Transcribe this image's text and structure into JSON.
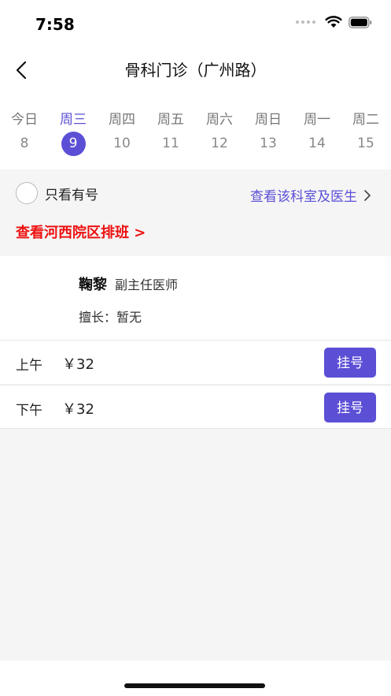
{
  "status_bar": {
    "time": "7:58",
    "icons": [
      "signal-icon",
      "wifi-icon",
      "battery-icon"
    ]
  },
  "nav": {
    "title": "骨科门诊（广州路）",
    "back_icon": "chevron-left-icon"
  },
  "dates": [
    {
      "weekday": "今日",
      "day": "8",
      "selected": false
    },
    {
      "weekday": "周三",
      "day": "9",
      "selected": true
    },
    {
      "weekday": "周四",
      "day": "10",
      "selected": false
    },
    {
      "weekday": "周五",
      "day": "11",
      "selected": false
    },
    {
      "weekday": "周六",
      "day": "12",
      "selected": false
    },
    {
      "weekday": "周日",
      "day": "13",
      "selected": false
    },
    {
      "weekday": "周一",
      "day": "14",
      "selected": false
    },
    {
      "weekday": "周二",
      "day": "15",
      "selected": false
    }
  ],
  "filter": {
    "only_available_label": "只看有号",
    "only_available_checked": false,
    "view_dept_label": "查看该科室及医生",
    "hexi_link": "查看河西院区排班 >"
  },
  "doctor": {
    "name": "鞠黎",
    "title": "副主任医师",
    "specialty": "擅长：暂无"
  },
  "slots": [
    {
      "period": "上午",
      "price": "￥32",
      "button": "挂号"
    },
    {
      "period": "下午",
      "price": "￥32",
      "button": "挂号"
    }
  ],
  "colors": {
    "accent": "#5b4fd6",
    "link_red": "#ee1111",
    "background": "#f5f5f5"
  }
}
